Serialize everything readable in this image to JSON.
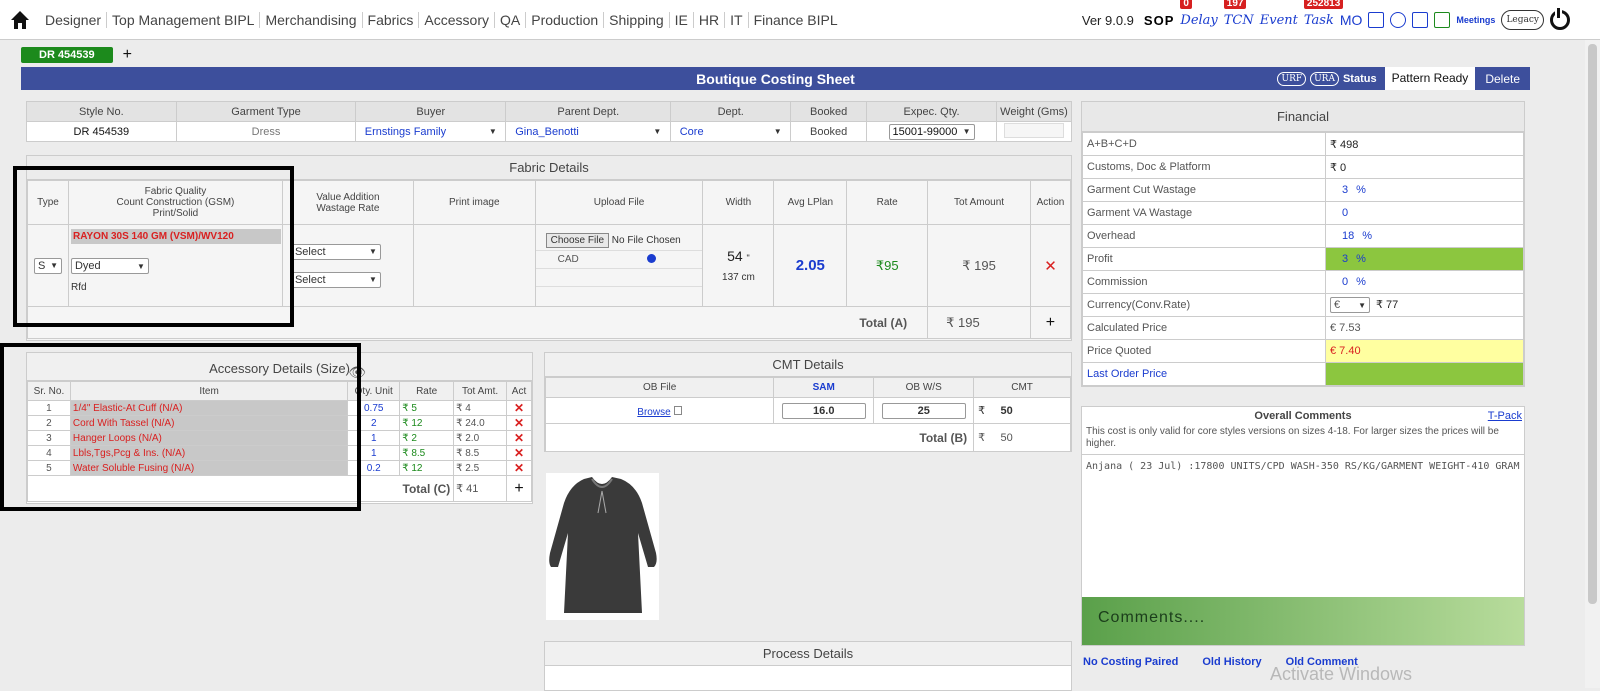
{
  "nav": [
    "Designer",
    "Top Management BIPL",
    "Merchandising",
    "Fabrics",
    "Accessory",
    "QA",
    "Production",
    "Shipping",
    "IE",
    "HR",
    "IT",
    "Finance BIPL"
  ],
  "topright": {
    "version": "Ver 9.0.9",
    "sop": "SOP",
    "delay": "Delay",
    "delay_count": "0",
    "tcn": "TCN",
    "tcn_count": "197",
    "event": "Event",
    "task": "Task",
    "task_count": "252813",
    "mo": "MO",
    "meetings": "Meetings",
    "legacy": "Legacy"
  },
  "tab": {
    "active": "DR 454539",
    "add": "+"
  },
  "titlebar": {
    "title": "Boutique Costing Sheet",
    "urf": "URF",
    "ura": "URA",
    "status": "Status",
    "pattern_ready": "Pattern Ready",
    "delete": "Delete"
  },
  "style": {
    "headers": [
      "Style No.",
      "Garment Type",
      "Buyer",
      "Parent Dept.",
      "Dept.",
      "Booked",
      "Expec. Qty.",
      "Weight (Gms)"
    ],
    "style_no": "DR 454539",
    "garment_type": "Dress",
    "buyer": "Ernstings Family",
    "parent_dept": "Gina_Benotti",
    "dept": "Core",
    "booked": "Booked",
    "expec_qty": "15001-99000",
    "weight": ""
  },
  "fabric": {
    "title": "Fabric Details",
    "headers": {
      "type": "Type",
      "quality1": "Fabric Quality",
      "quality2": "Count Construction (GSM)",
      "quality3": "Print/Solid",
      "va1": "Value Addition",
      "va2": "Wastage Rate",
      "print": "Print image",
      "upload": "Upload File",
      "width": "Width",
      "avg": "Avg LPlan",
      "rate": "Rate",
      "tot": "Tot Amount",
      "action": "Action"
    },
    "type_value": "S",
    "quality_name": "RAYON 30S 140 GM (VSM)/WV120",
    "dyed": "Dyed",
    "rfd": "Rfd",
    "va_select1": "Select",
    "va_select2": "Select",
    "choose_file": "Choose File",
    "no_file": "No File Chosen",
    "cad": "CAD",
    "width_in": "54",
    "width_unit": "\"",
    "width_cm": "137 cm",
    "avg_lplan": "2.05",
    "rate": "₹95",
    "tot_amount": "₹ 195",
    "total_label": "Total (A)",
    "total_value": "₹ 195"
  },
  "accessory": {
    "title": "Accessory Details (Size)",
    "headers": [
      "Sr. No.",
      "Item",
      "Qty. Unit",
      "Rate",
      "Tot Amt.",
      "Act"
    ],
    "rows": [
      {
        "sr": "1",
        "item": "1/4\" Elastic-At Cuff (N/A)",
        "qty": "0.75",
        "rate": "₹ 5",
        "tot": "₹ 4"
      },
      {
        "sr": "2",
        "item": "Cord With Tassel (N/A)",
        "qty": "2",
        "rate": "₹ 12",
        "tot": "₹ 24.0"
      },
      {
        "sr": "3",
        "item": "Hanger Loops (N/A)",
        "qty": "1",
        "rate": "₹ 2",
        "tot": "₹ 2.0"
      },
      {
        "sr": "4",
        "item": "Lbls,Tgs,Pcg & Ins. (N/A)",
        "qty": "1",
        "rate": "₹ 8.5",
        "tot": "₹ 8.5"
      },
      {
        "sr": "5",
        "item": "Water Soluble Fusing (N/A)",
        "qty": "0.2",
        "rate": "₹ 12",
        "tot": "₹ 2.5"
      }
    ],
    "total_label": "Total (C)",
    "total_value": "₹ 41"
  },
  "cmt": {
    "title": "CMT Details",
    "headers": [
      "OB File",
      "SAM",
      "OB W/S",
      "CMT"
    ],
    "browse": "Browse",
    "sam": "16.0",
    "ob_ws": "25",
    "cmt_symbol": "₹",
    "cmt_value": "50",
    "total_label": "Total (B)",
    "total_symbol": "₹",
    "total_value": "50"
  },
  "process": {
    "title": "Process Details"
  },
  "financial": {
    "title": "Financial",
    "rows": [
      {
        "label": "A+B+C+D",
        "value": "₹ 498"
      },
      {
        "label": "Customs, Doc & Platform",
        "value": "₹ 0"
      },
      {
        "label": "Garment Cut Wastage",
        "value": "3",
        "unit": "%"
      },
      {
        "label": "Garment VA Wastage",
        "value": "0",
        "unit": ""
      },
      {
        "label": "Overhead",
        "value": "18",
        "unit": "%"
      },
      {
        "label": "Profit",
        "value": "3",
        "unit": "%"
      },
      {
        "label": "Commission",
        "value": "0",
        "unit": "%"
      },
      {
        "label": "Currency(Conv.Rate)",
        "currency": "€",
        "value": "₹ 77"
      },
      {
        "label": "Calculated Price",
        "value": "€ 7.53"
      },
      {
        "label": "Price Quoted",
        "value": "€ 7.40"
      },
      {
        "label": "Last Order Price",
        "value": ""
      }
    ]
  },
  "comments": {
    "title": "Overall Comments",
    "tpack": "T-Pack",
    "note": "This cost is only valid for core styles versions on sizes 4-18. For larger sizes the prices will be higher.",
    "entry": "Anjana ( 23 Jul) :17800 UNITS/CPD WASH-350 RS/KG/GARMENT WEIGHT-410 GRAM",
    "placeholder": "Comments...."
  },
  "footer_links": [
    "No Costing Paired",
    "Old History",
    "Old Comment"
  ],
  "watermark": "Activate Windows",
  "colors": {
    "title_bar": "#3d4f9c",
    "green_tab": "#1c8a1c",
    "profit_green": "#8cc63f",
    "price_yellow": "#ffffa0",
    "error_red": "#d92020"
  }
}
